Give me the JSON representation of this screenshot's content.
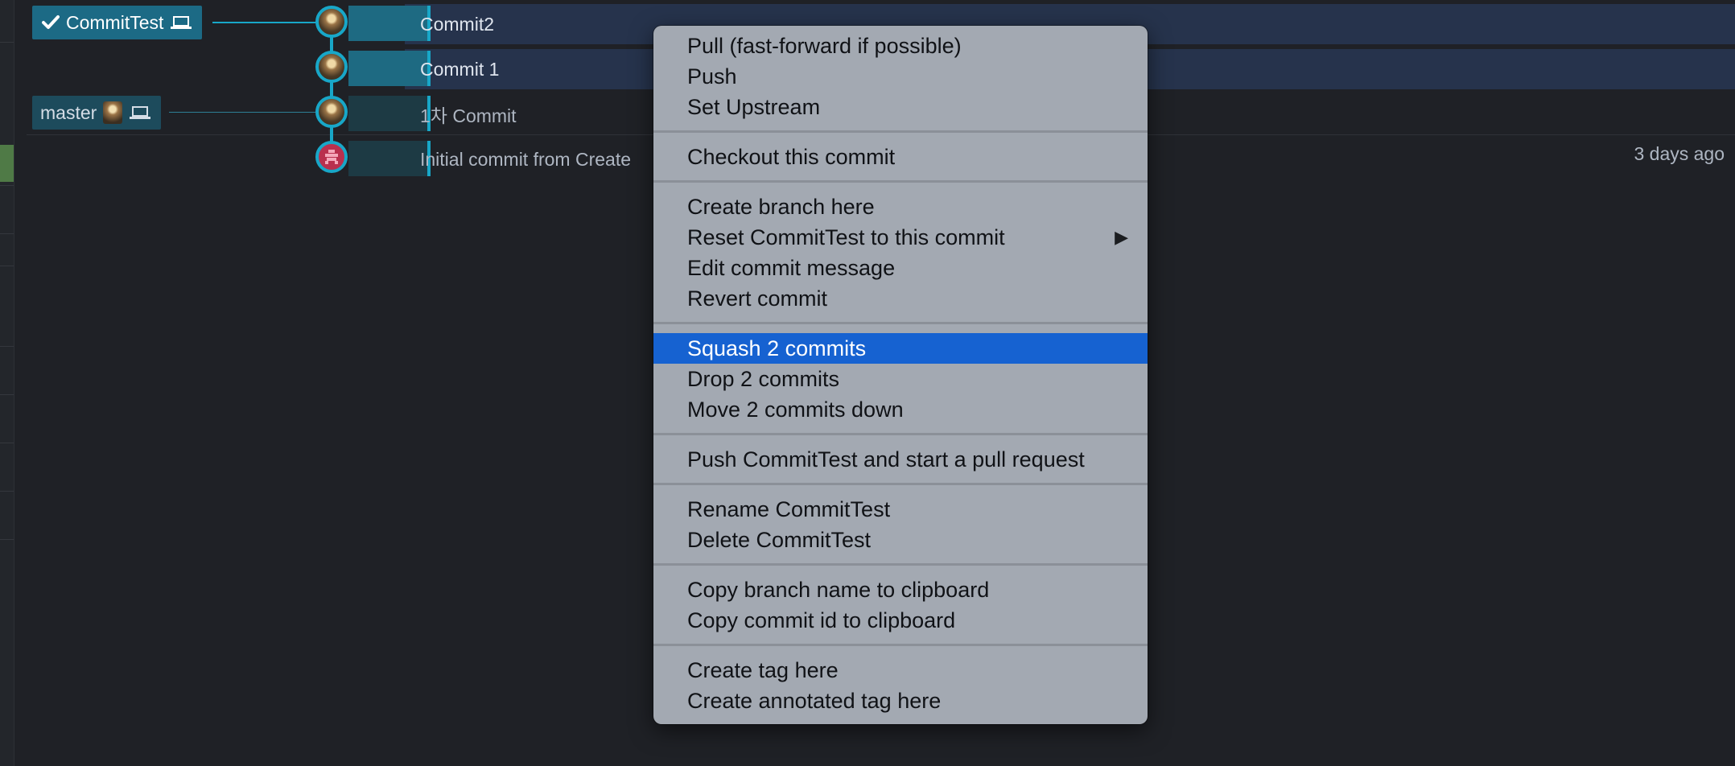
{
  "branches": {
    "current": {
      "name": "CommitTest",
      "check_icon": "check-icon",
      "laptop_icon": "laptop-icon"
    },
    "other": {
      "name": "master",
      "avatar_icon": "avatar-icon",
      "laptop_icon": "laptop-icon"
    }
  },
  "commits": [
    {
      "message": "Commit2"
    },
    {
      "message": "Commit 1"
    },
    {
      "message": "1차 Commit"
    },
    {
      "message": "Initial commit from Create",
      "date": "3 days ago"
    }
  ],
  "context_menu": {
    "groups": [
      [
        "Pull (fast-forward if possible)",
        "Push",
        "Set Upstream"
      ],
      [
        "Checkout this commit"
      ],
      [
        "Create branch here",
        "Reset CommitTest to this commit",
        "Edit commit message",
        "Revert commit"
      ],
      [
        "Squash 2 commits",
        "Drop 2 commits",
        "Move 2 commits down"
      ],
      [
        "Push CommitTest and start a pull request"
      ],
      [
        "Rename CommitTest",
        "Delete CommitTest"
      ],
      [
        "Copy branch name to clipboard",
        "Copy commit id to clipboard"
      ],
      [
        "Create tag here",
        "Create annotated tag here"
      ]
    ],
    "highlighted": "Squash 2 commits",
    "submenu_item": "Reset CommitTest to this commit",
    "submenu_arrow": "▶"
  },
  "colors": {
    "background": "#1f2126",
    "accent": "#18a7c8",
    "menu_background": "#a3a9b2",
    "menu_highlight": "#1662d1"
  }
}
